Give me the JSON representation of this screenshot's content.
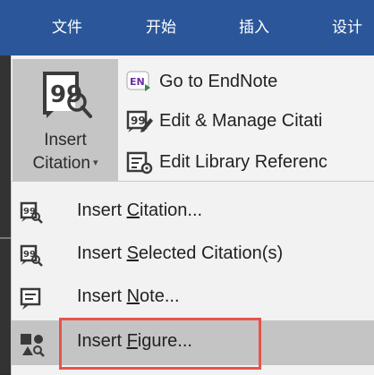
{
  "tabs": [
    "文件",
    "开始",
    "插入",
    "设计"
  ],
  "ribbon": {
    "insert_citation": {
      "line1": "Insert",
      "line2": "Citation",
      "caret": "▾",
      "icon": "insert-citation-icon"
    },
    "commands": [
      {
        "label": "Go to EndNote",
        "icon": "endnote-logo-icon",
        "badge": "EN"
      },
      {
        "label": "Edit & Manage Citati",
        "icon": "edit-manage-citations-icon"
      },
      {
        "label": "Edit Library Referenc",
        "icon": "edit-library-references-icon"
      }
    ]
  },
  "menu": {
    "items": [
      {
        "pre": "Insert ",
        "key": "C",
        "post": "itation...",
        "icon": "insert-citation-icon",
        "highlighted": false
      },
      {
        "pre": "Insert ",
        "key": "S",
        "post": "elected Citation(s)",
        "icon": "insert-selected-citation-icon",
        "highlighted": false
      },
      {
        "pre": "Insert ",
        "key": "N",
        "post": "ote...",
        "icon": "insert-note-icon",
        "highlighted": false
      },
      {
        "pre": "Insert ",
        "key": "F",
        "post": "igure...",
        "icon": "insert-figure-icon",
        "highlighted": true
      }
    ]
  },
  "colors": {
    "tabbar": "#2b579a",
    "highlight": "#c4c4c4",
    "outline": "#e8534b"
  }
}
